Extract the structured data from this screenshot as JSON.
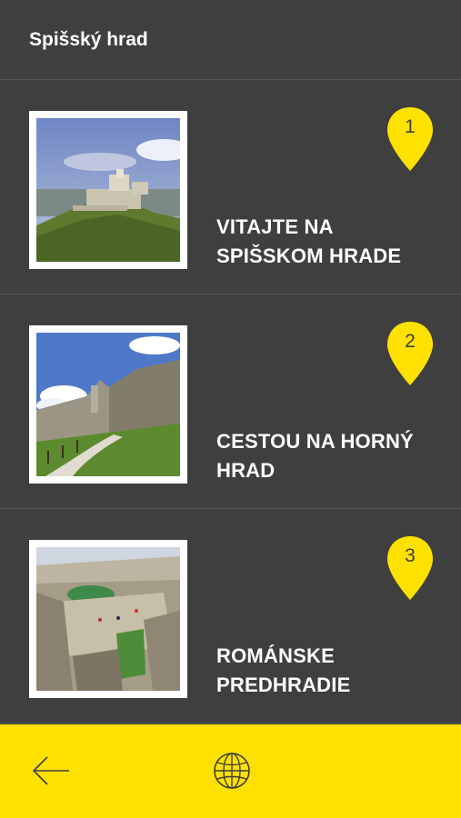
{
  "header": {
    "title": "Spišský hrad"
  },
  "stops": [
    {
      "number": "1",
      "label": "Vitajte na Spišskom hrade",
      "image": "castle-hill-photo"
    },
    {
      "number": "2",
      "label": "Cestou na Horný hrad",
      "image": "castle-walls-path-photo"
    },
    {
      "number": "3",
      "label": "Románske predhradie",
      "image": "romanesque-courtyard-photo"
    }
  ],
  "bottom_bar": {
    "back_icon": "arrow-left-icon",
    "language_icon": "globe-icon"
  },
  "colors": {
    "background": "#3f3f3f",
    "accent": "#ffe100",
    "text": "#ffffff"
  }
}
